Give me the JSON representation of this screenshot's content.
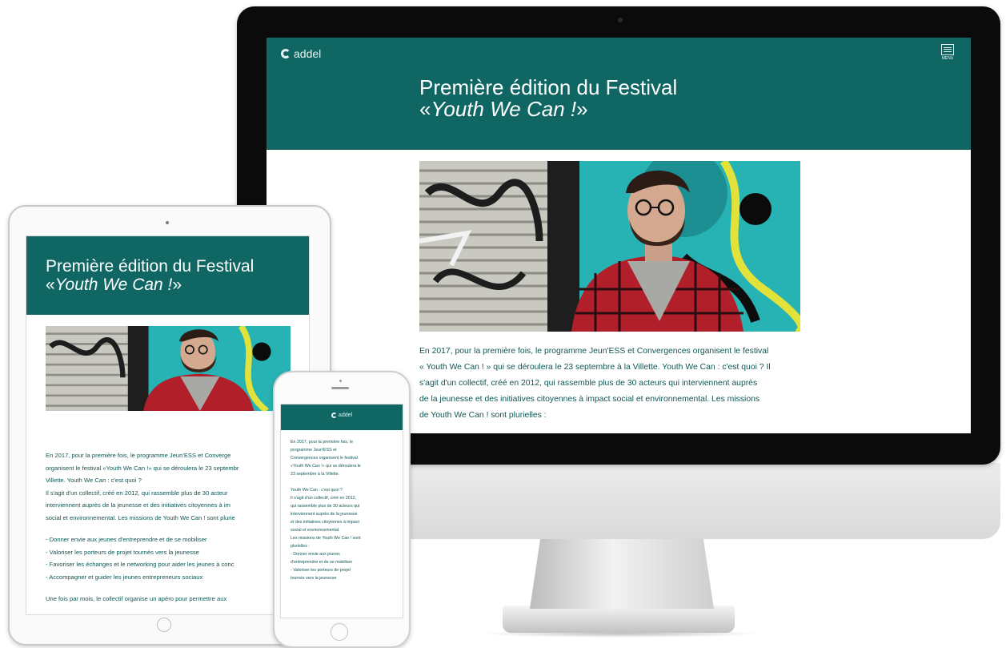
{
  "brand": {
    "logo_text": "addel"
  },
  "desktop": {
    "menu_label": "MENU",
    "title_line1": "Première édition du Festival",
    "title_line2_prefix": "«",
    "title_line2_italic": "Youth We Can !",
    "title_line2_suffix": "»",
    "photo_description_icon": "photo-man-graffiti",
    "body_lines": [
      "En 2017, pour la première fois, le programme Jeun'ESS et Convergences organisent le festival",
      "« Youth We Can ! » qui se déroulera le 23 septembre à la Villette. Youth We Can : c'est quoi ?  Il",
      "s'agit d'un collectif, créé en 2012, qui rassemble plus de 30 acteurs qui interviennent auprès",
      "de la jeunesse et des initiatives citoyennes à impact social et environnemental. Les missions",
      "de Youth We Can ! sont plurielles :"
    ]
  },
  "tablet": {
    "title_line1": "Première édition du Festival",
    "title_line2_prefix": "«",
    "title_line2_italic": "Youth We Can !",
    "title_line2_suffix": "»",
    "paragraph1": [
      "En 2017, pour la première fois, le programme Jeun'ESS et Converge",
      "organisent le festival «Youth We Can !» qui se déroulera le 23 septembr",
      "Villette. Youth We Can : c'est quoi ?",
      "Il s'agit d'un collectif, créé en 2012, qui rassemble plus de 30 acteur",
      "interviennent auprès de la jeunesse et des initiatives citoyennes à im",
      "social et environnemental. Les missions de Youth We Can ! sont plurie"
    ],
    "missions": [
      "- Donner envie aux jeunes d'entreprendre et de se mobiliser",
      "- Valoriser les porteurs de projet tournés vers la jeunesse",
      "- Favoriser les échanges et le networking pour aider les jeunes à conc",
      "- Accompagner et guider les jeunes entrepreneurs sociaux"
    ],
    "closing": "Une fois par mois, le collectif organise un apéro pour permettre aux"
  },
  "phone": {
    "paragraph1": [
      "En 2017, pour la première fois, le",
      "programme Jeun'ESS et",
      "Convergences organisent le festival",
      "«Youth We Can !» qui se déroulera le",
      "23 septembre à la Villette."
    ],
    "paragraph2": [
      "Youth We Can : c'est quoi ?",
      "Il s'agit d'un collectif, créé en 2012,",
      "qui rassemble plus de 30 acteurs qui",
      "interviennent auprès de la jeunesse",
      "et des initiatives citoyennes à impact",
      "social et environnemental.",
      "Les missions de Youth We Can ! sont",
      "plurielles :",
      "- Donner envie aux jeunes",
      "d'entreprendre et de se mobiliser",
      "- Valoriser les porteurs de projet",
      "tournés vers la jeunesse"
    ]
  },
  "colors": {
    "brand_teal": "#0f6663",
    "text_teal": "#0f5755"
  }
}
